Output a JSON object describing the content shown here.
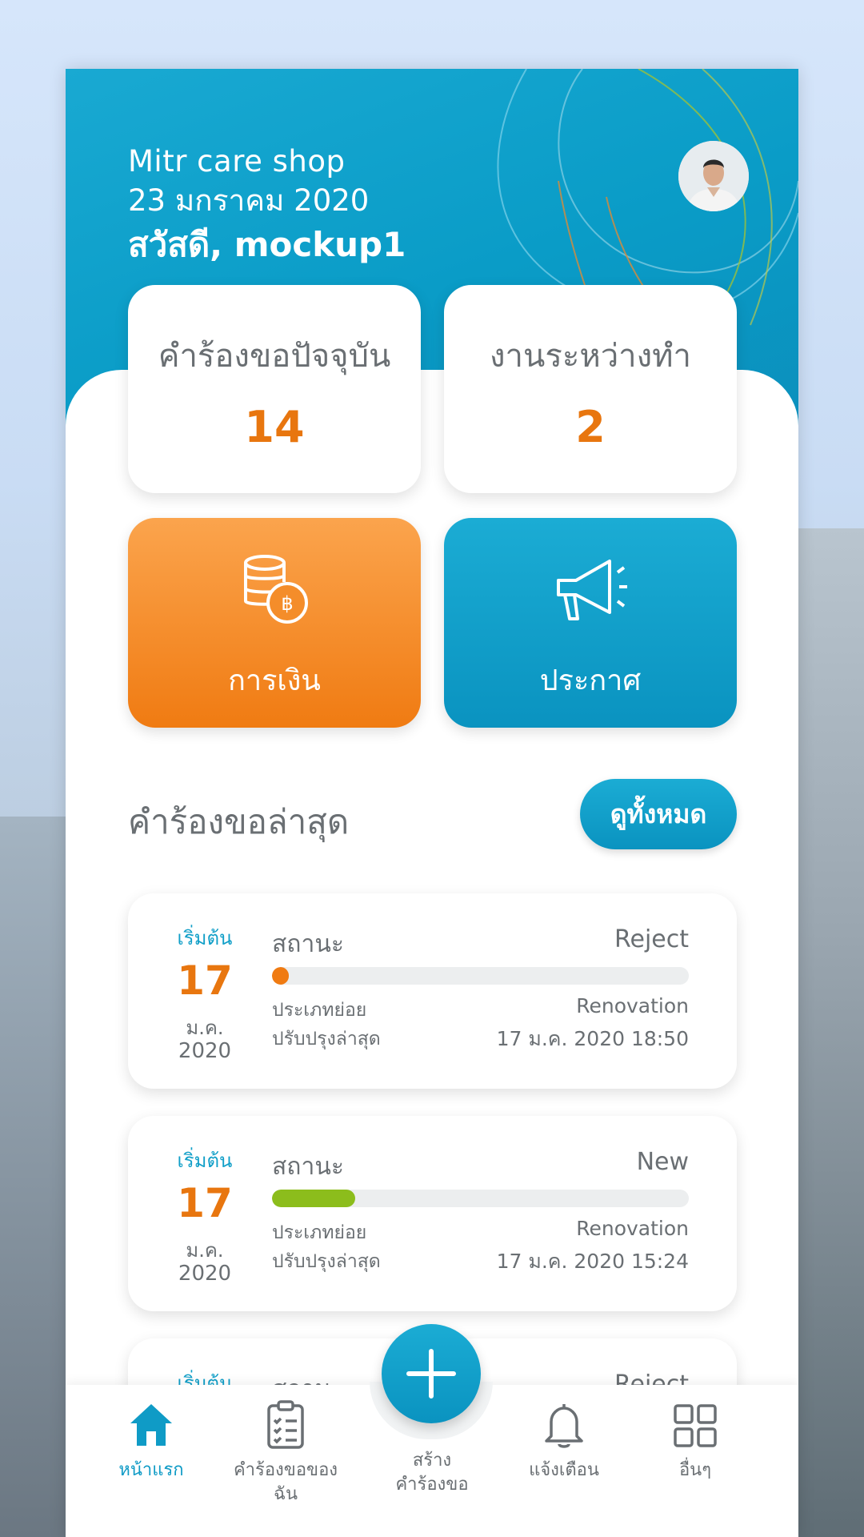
{
  "header": {
    "shop_name": "Mitr care shop",
    "date": "23 มกราคม 2020",
    "greeting": "สวัสดี, mockup1"
  },
  "stats": [
    {
      "label": "คำร้องขอปัจจุบัน",
      "value": "14"
    },
    {
      "label": "งานระหว่างทำ",
      "value": "2"
    }
  ],
  "actions": [
    {
      "label": "การเงิน",
      "icon": "coins-baht-icon"
    },
    {
      "label": "ประกาศ",
      "icon": "megaphone-icon"
    }
  ],
  "latest": {
    "title": "คำร้องขอล่าสุด",
    "view_all": "ดูทั้งหมด",
    "requests": [
      {
        "start_label": "เริ่มต้น",
        "day": "17",
        "month": "ม.ค.",
        "year": "2020",
        "status_label": "สถานะ",
        "status": "Reject",
        "progress": 0.04,
        "progress_color": "#f07b12",
        "sub_type_label": "ประเภทย่อย",
        "sub_type": "Renovation",
        "updated_label": "ปรับปรุงล่าสุด",
        "updated": "17 ม.ค. 2020 18:50"
      },
      {
        "start_label": "เริ่มต้น",
        "day": "17",
        "month": "ม.ค.",
        "year": "2020",
        "status_label": "สถานะ",
        "status": "New",
        "progress": 0.2,
        "progress_color": "#8cbd1c",
        "sub_type_label": "ประเภทย่อย",
        "sub_type": "Renovation",
        "updated_label": "ปรับปรุงล่าสุด",
        "updated": "17 ม.ค. 2020 15:24"
      },
      {
        "start_label": "เริ่มต้น",
        "status_label": "สถานะ",
        "status": "Reject"
      }
    ]
  },
  "nav": {
    "home": "หน้าแรก",
    "my_requests_1": "คำร้องขอของ",
    "my_requests_2": "ฉัน",
    "create_1": "สร้าง",
    "create_2": "คำร้องขอ",
    "notifications": "แจ้งเตือน",
    "more": "อื่นๆ"
  },
  "colors": {
    "accent": "#0f9bc6",
    "orange": "#e8760f"
  }
}
